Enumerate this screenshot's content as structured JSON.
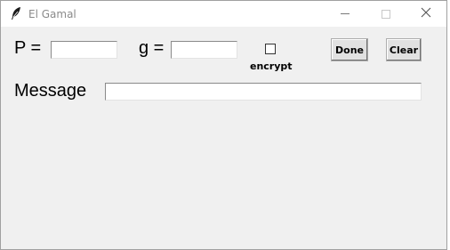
{
  "window": {
    "title": "El Gamal",
    "app_icon": "feather-icon",
    "controls": [
      "minimize-icon",
      "maximize-icon",
      "close-icon"
    ]
  },
  "form": {
    "p_label": "P =",
    "p_value": "",
    "g_label": "g =",
    "g_value": "",
    "encrypt_label": "encrypt",
    "encrypt_checked": false,
    "done_label": "Done",
    "clear_label": "Clear",
    "message_label": "Message",
    "message_value": ""
  }
}
